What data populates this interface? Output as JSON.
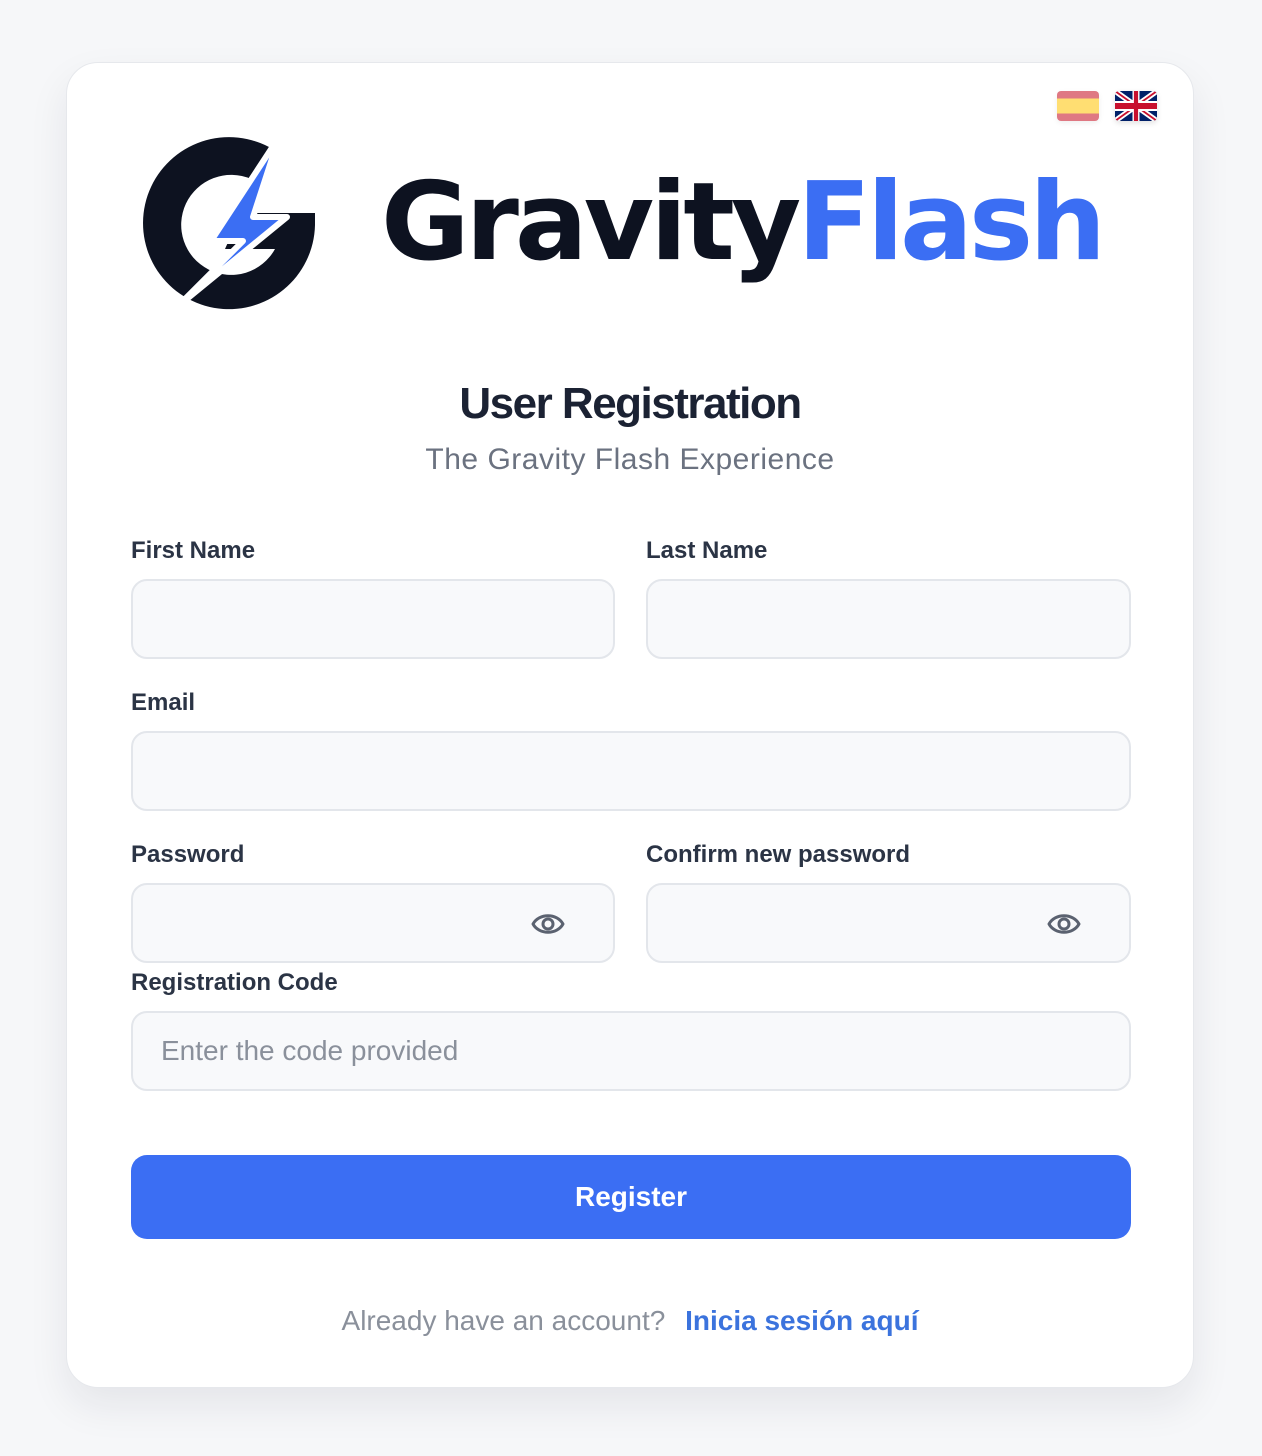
{
  "brand": {
    "word1": "Gravity",
    "word2": "Flash",
    "dark_color": "#0d1220",
    "accent_color": "#3b6ef3",
    "logo_icon": "lightning-g-icon"
  },
  "language": {
    "options": [
      {
        "code": "es",
        "icon": "spain-flag-icon",
        "selected": false
      },
      {
        "code": "en",
        "icon": "uk-flag-icon",
        "selected": true
      }
    ]
  },
  "header": {
    "title": "User Registration",
    "subtitle": "The Gravity Flash Experience"
  },
  "form": {
    "first_name": {
      "label": "First Name",
      "value": "",
      "placeholder": ""
    },
    "last_name": {
      "label": "Last Name",
      "value": "",
      "placeholder": ""
    },
    "email": {
      "label": "Email",
      "value": "",
      "placeholder": ""
    },
    "password": {
      "label": "Password",
      "value": "",
      "placeholder": "",
      "toggle_icon": "eye-icon"
    },
    "confirm_password": {
      "label": "Confirm new password",
      "value": "",
      "placeholder": "",
      "toggle_icon": "eye-icon"
    },
    "registration_code": {
      "label": "Registration Code",
      "value": "",
      "placeholder": "Enter the code provided"
    },
    "submit_label": "Register"
  },
  "footer": {
    "prompt": "Already have an account?",
    "link_label": "Inicia sesión aquí"
  }
}
